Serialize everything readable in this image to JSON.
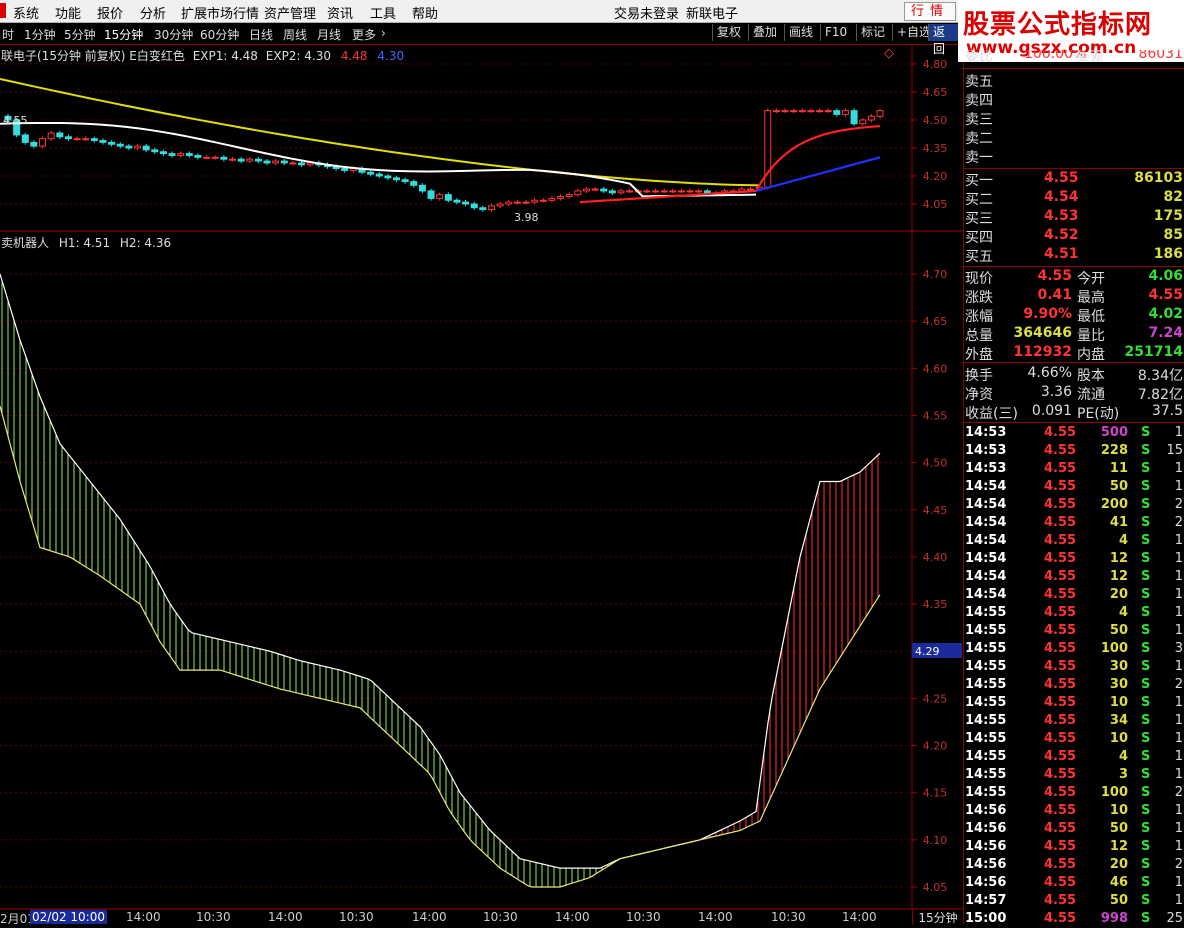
{
  "menu": {
    "items": [
      "系统",
      "功能",
      "报价",
      "分析",
      "扩展市场行情",
      "资产管理",
      "资讯",
      "工具",
      "帮助"
    ],
    "login_status": "交易未登录",
    "stock_name": "新联电子",
    "quote_button": "行情"
  },
  "banner": {
    "title": "股票公式指标网",
    "url": "www.gszx.com.cn"
  },
  "periods": {
    "items": [
      "时",
      "1分钟",
      "5分钟",
      "15分钟",
      "30分钟",
      "60分钟",
      "日线",
      "周线",
      "月线",
      "更多"
    ],
    "active": "15分钟",
    "more_arrow": "›"
  },
  "toolbar": [
    "复权",
    "叠加",
    "画线",
    "F10",
    "标记",
    "+自选",
    "返回"
  ],
  "top_panel": {
    "header_name": "联电子(15分钟 前复权) E白变红色",
    "exp1_label": "EXP1: 4.48",
    "exp2_label": "EXP2: 4.30",
    "exp1_extra": "4.48",
    "exp2_extra": "4.30",
    "high_label": "4.55",
    "low_label": "3.98",
    "diamond": "◇",
    "price_axis": [
      "4.80",
      "4.65",
      "4.50",
      "4.35",
      "4.20",
      "4.05"
    ]
  },
  "bottom_panel": {
    "header_name": "卖机器人",
    "h1_label": "H1: 4.51",
    "h2_label": "H2: 4.36",
    "price_axis": [
      "4.70",
      "4.65",
      "4.60",
      "4.55",
      "4.50",
      "4.45",
      "4.40",
      "4.35",
      "4.30",
      "4.25",
      "4.20",
      "4.15",
      "4.10",
      "4.05"
    ],
    "current_tag": "4.29"
  },
  "time_axis": {
    "labels": [
      "2月01",
      "02/02 10:00",
      "14:00",
      "10:30",
      "14:00",
      "10:30",
      "14:00",
      "10:30",
      "14:00",
      "10:30",
      "14:00",
      "10:30",
      "14:00"
    ],
    "period": "15分钟"
  },
  "order_book": {
    "top_partial": {
      "label": "委比",
      "value": "100.00%",
      "label2": "委差",
      "value2": "86031"
    },
    "sells": [
      {
        "label": "卖五"
      },
      {
        "label": "卖四"
      },
      {
        "label": "卖三"
      },
      {
        "label": "卖二"
      },
      {
        "label": "卖一"
      }
    ],
    "buys": [
      {
        "label": "买一",
        "price": "4.55",
        "vol": "86103"
      },
      {
        "label": "买二",
        "price": "4.54",
        "vol": "82"
      },
      {
        "label": "买三",
        "price": "4.53",
        "vol": "175"
      },
      {
        "label": "买四",
        "price": "4.52",
        "vol": "85"
      },
      {
        "label": "买五",
        "price": "4.51",
        "vol": "186"
      }
    ]
  },
  "quote": {
    "rows": [
      {
        "l1": "现价",
        "v1": "4.55",
        "c1": "#ff3333",
        "l2": "今开",
        "v2": "4.06",
        "c2": "#33dd33"
      },
      {
        "l1": "涨跌",
        "v1": "0.41",
        "c1": "#ff3333",
        "l2": "最高",
        "v2": "4.55",
        "c2": "#ff3333"
      },
      {
        "l1": "涨幅",
        "v1": "9.90%",
        "c1": "#ff3333",
        "l2": "最低",
        "v2": "4.02",
        "c2": "#33dd33"
      },
      {
        "l1": "总量",
        "v1": "364646",
        "c1": "#dddd44",
        "l2": "量比",
        "v2": "7.24",
        "c2": "#cc44cc"
      },
      {
        "l1": "外盘",
        "v1": "112932",
        "c1": "#ff3333",
        "l2": "内盘",
        "v2": "251714",
        "c2": "#33dd33"
      }
    ],
    "rows2": [
      {
        "l1": "换手",
        "v1": "4.66%",
        "l2": "股本",
        "v2": "8.34亿"
      },
      {
        "l1": "净资",
        "v1": "3.36",
        "l2": "流通",
        "v2": "7.82亿"
      },
      {
        "l1": "收益(三)",
        "v1": "0.091",
        "l2": "PE(动)",
        "v2": "37.5"
      }
    ]
  },
  "ticks": [
    {
      "t": "14:53",
      "p": "4.55",
      "v": "500",
      "s": "S",
      "n": "1"
    },
    {
      "t": "14:53",
      "p": "4.55",
      "v": "228",
      "s": "S",
      "n": "15"
    },
    {
      "t": "14:53",
      "p": "4.55",
      "v": "11",
      "s": "S",
      "n": "1"
    },
    {
      "t": "14:54",
      "p": "4.55",
      "v": "50",
      "s": "S",
      "n": "1"
    },
    {
      "t": "14:54",
      "p": "4.55",
      "v": "200",
      "s": "S",
      "n": "2"
    },
    {
      "t": "14:54",
      "p": "4.55",
      "v": "41",
      "s": "S",
      "n": "2"
    },
    {
      "t": "14:54",
      "p": "4.55",
      "v": "4",
      "s": "S",
      "n": "1"
    },
    {
      "t": "14:54",
      "p": "4.55",
      "v": "12",
      "s": "S",
      "n": "1"
    },
    {
      "t": "14:54",
      "p": "4.55",
      "v": "12",
      "s": "S",
      "n": "1"
    },
    {
      "t": "14:54",
      "p": "4.55",
      "v": "20",
      "s": "S",
      "n": "1"
    },
    {
      "t": "14:55",
      "p": "4.55",
      "v": "4",
      "s": "S",
      "n": "1"
    },
    {
      "t": "14:55",
      "p": "4.55",
      "v": "50",
      "s": "S",
      "n": "1"
    },
    {
      "t": "14:55",
      "p": "4.55",
      "v": "100",
      "s": "S",
      "n": "3"
    },
    {
      "t": "14:55",
      "p": "4.55",
      "v": "30",
      "s": "S",
      "n": "1"
    },
    {
      "t": "14:55",
      "p": "4.55",
      "v": "30",
      "s": "S",
      "n": "2"
    },
    {
      "t": "14:55",
      "p": "4.55",
      "v": "10",
      "s": "S",
      "n": "1"
    },
    {
      "t": "14:55",
      "p": "4.55",
      "v": "34",
      "s": "S",
      "n": "1"
    },
    {
      "t": "14:55",
      "p": "4.55",
      "v": "10",
      "s": "S",
      "n": "1"
    },
    {
      "t": "14:55",
      "p": "4.55",
      "v": "4",
      "s": "S",
      "n": "1"
    },
    {
      "t": "14:55",
      "p": "4.55",
      "v": "3",
      "s": "S",
      "n": "1"
    },
    {
      "t": "14:55",
      "p": "4.55",
      "v": "100",
      "s": "S",
      "n": "2"
    },
    {
      "t": "14:56",
      "p": "4.55",
      "v": "10",
      "s": "S",
      "n": "1"
    },
    {
      "t": "14:56",
      "p": "4.55",
      "v": "50",
      "s": "S",
      "n": "1"
    },
    {
      "t": "14:56",
      "p": "4.55",
      "v": "12",
      "s": "S",
      "n": "1"
    },
    {
      "t": "14:56",
      "p": "4.55",
      "v": "20",
      "s": "S",
      "n": "2"
    },
    {
      "t": "14:56",
      "p": "4.55",
      "v": "46",
      "s": "S",
      "n": "1"
    },
    {
      "t": "14:57",
      "p": "4.55",
      "v": "50",
      "s": "S",
      "n": "1"
    },
    {
      "t": "15:00",
      "p": "4.55",
      "v": "998",
      "s": "S",
      "n": "25"
    }
  ],
  "colors": {
    "up": "#ff3333",
    "down": "#33dddd",
    "yellow_line": "#e0e000",
    "white_line": "#ffffff",
    "red_line": "#ff2020",
    "blue_line": "#2020ff",
    "grid": "#800000",
    "band_green": "#99ee55",
    "band_red": "#ff3030"
  }
}
